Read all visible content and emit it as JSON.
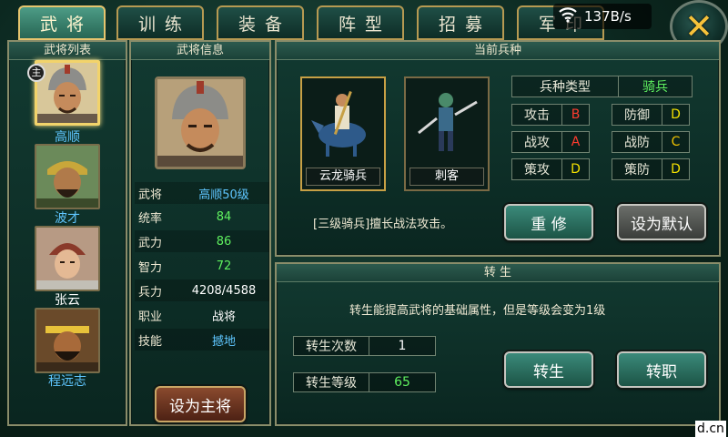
{
  "tabs": [
    {
      "label": "武将",
      "active": true
    },
    {
      "label": "训练",
      "active": false
    },
    {
      "label": "装备",
      "active": false
    },
    {
      "label": "阵型",
      "active": false
    },
    {
      "label": "招募",
      "active": false
    },
    {
      "label": "军印",
      "active": false
    }
  ],
  "status": {
    "net_speed": "137B/s",
    "icon": "wifi-icon"
  },
  "close": {
    "glyph": "✕"
  },
  "roster": {
    "title": "武将列表",
    "master_badge": "主",
    "generals": [
      {
        "name": "高顺",
        "color": "blue",
        "selected": true
      },
      {
        "name": "波才",
        "color": "blue",
        "selected": false
      },
      {
        "name": "张云",
        "color": "white",
        "selected": false
      },
      {
        "name": "程远志",
        "color": "blue",
        "selected": false
      }
    ]
  },
  "info": {
    "title": "武将信息",
    "rows": [
      {
        "key": "武将",
        "value": "高顺50级",
        "color": "blue"
      },
      {
        "key": "统率",
        "value": "84",
        "color": "green"
      },
      {
        "key": "武力",
        "value": "86",
        "color": "green"
      },
      {
        "key": "智力",
        "value": "72",
        "color": "green"
      },
      {
        "key": "兵力",
        "value": "4208/4588",
        "color": "white"
      },
      {
        "key": "职业",
        "value": "战将",
        "color": "white"
      },
      {
        "key": "技能",
        "value": "撼地",
        "color": "blue"
      }
    ],
    "set_master_button": "设为主将"
  },
  "troop": {
    "title": "当前兵种",
    "units": [
      {
        "name": "云龙骑兵",
        "selected": true
      },
      {
        "name": "刺客",
        "selected": false
      }
    ],
    "type_label": "兵种类型",
    "type_value": "骑兵",
    "attributes": [
      {
        "label": "攻击",
        "grade": "B",
        "color": "red"
      },
      {
        "label": "防御",
        "grade": "D",
        "color": "yellow"
      },
      {
        "label": "战攻",
        "grade": "A",
        "color": "red"
      },
      {
        "label": "战防",
        "grade": "C",
        "color": "gold"
      },
      {
        "label": "策攻",
        "grade": "D",
        "color": "yellow"
      },
      {
        "label": "策防",
        "grade": "D",
        "color": "yellow"
      }
    ],
    "description": "[三级骑兵]擅长战法攻击。",
    "retrain_button": "重 修",
    "set_default_button": "设为默认"
  },
  "rebirth": {
    "title": "转 生",
    "description": "转生能提高武将的基础属性，但是等级会变为1级",
    "count_label": "转生次数",
    "count_value": "1",
    "level_label": "转生等级",
    "level_value": "65",
    "rebirth_button": "转生",
    "change_job_button": "转职"
  },
  "watermark": "d.cn"
}
